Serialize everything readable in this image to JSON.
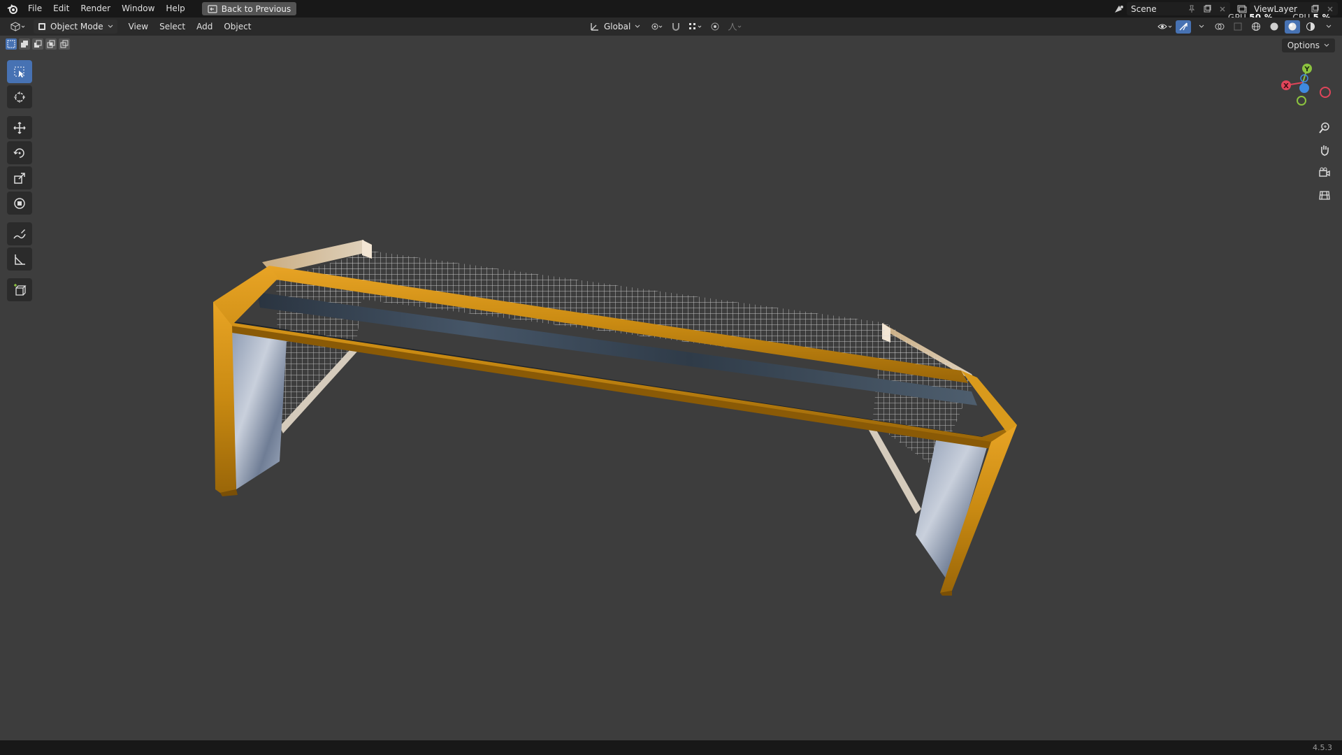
{
  "menubar": {
    "items": [
      "File",
      "Edit",
      "Render",
      "Window",
      "Help"
    ],
    "back_button": "Back to Previous"
  },
  "top_right": {
    "scene": "Scene",
    "view_layer": "ViewLayer",
    "gpu_label": "GPU",
    "gpu_value": "50 %",
    "cpu_label": "CPU",
    "cpu_value": "5 %"
  },
  "header": {
    "mode": "Object Mode",
    "menus": [
      "View",
      "Select",
      "Add",
      "Object"
    ],
    "transform_orientation": "Global",
    "options": "Options"
  },
  "toolbar": {
    "tools": [
      "select-box-icon",
      "cursor-icon",
      "move-icon",
      "rotate-icon",
      "scale-icon",
      "transform-icon",
      "annotate-icon",
      "measure-icon",
      "add-cube-icon"
    ],
    "active_tool": "select-box-icon"
  },
  "gizmo": {
    "axes": [
      "X",
      "Y",
      "Z"
    ],
    "colors": {
      "x": "#e0455a",
      "y": "#8cc33f",
      "z": "#3f8ae0"
    }
  },
  "status": {
    "version": "4.5.3"
  },
  "colors": {
    "accent": "#4772b3",
    "frame": "#c98a12",
    "viewport_bg": "#3d3d3d"
  }
}
